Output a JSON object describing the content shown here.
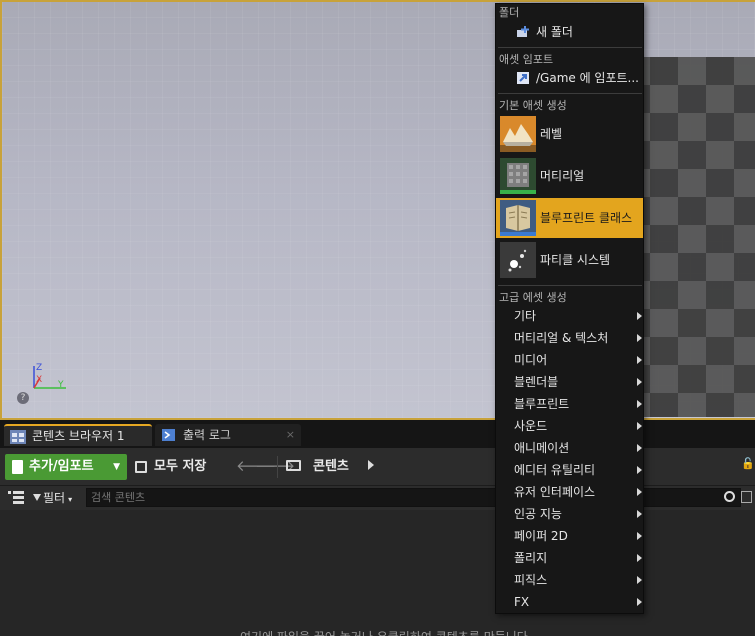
{
  "viewport": {
    "help_label": "?"
  },
  "tabs": [
    {
      "label": "콘텐츠 브라우저 1",
      "icon": "content-browser-icon",
      "close": "×"
    },
    {
      "label": "출력 로그",
      "icon": "output-log-icon",
      "close": "×"
    }
  ],
  "toolbar": {
    "add_import_label": "추가/임포트",
    "save_all_label": "모두 저장",
    "back_glyph": "🡐",
    "forward_glyph": "🡒",
    "path_label": "콘텐츠",
    "lock_glyph": "🔓"
  },
  "filterbar": {
    "filter_label": "필터",
    "caret": "▾",
    "search_placeholder": "검색 콘텐츠"
  },
  "content": {
    "empty_hint": "여기에 파일을 끌어 놓거나 우클릭하여 콘텐츠를 만듭니다"
  },
  "menu": {
    "folder_header": "폴더",
    "new_folder": "새 폴더",
    "import_header": "애셋 임포트",
    "import_item": "/Game 에 임포트...",
    "basic_header": "기본 애셋 생성",
    "basic_items": [
      {
        "label": "레벨",
        "icon": "level-icon"
      },
      {
        "label": "머티리얼",
        "icon": "material-icon"
      },
      {
        "label": "블루프린트 클래스",
        "icon": "blueprint-class-icon"
      },
      {
        "label": "파티클 시스템",
        "icon": "particle-system-icon"
      }
    ],
    "advanced_header": "고급 에셋 생성",
    "advanced_items": [
      "기타",
      "머티리얼 & 텍스처",
      "미디어",
      "블렌더블",
      "블루프린트",
      "사운드",
      "애니메이션",
      "에디터 유틸리티",
      "유저 인터페이스",
      "인공 지능",
      "페이퍼 2D",
      "폴리지",
      "피직스",
      "FX"
    ]
  },
  "colors": {
    "accent": "#e3a51e",
    "add_button": "#4a9a34",
    "menu_bg": "#171717"
  }
}
